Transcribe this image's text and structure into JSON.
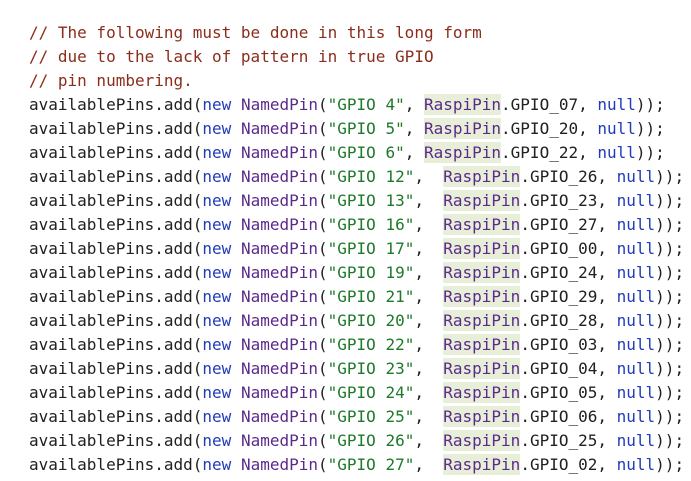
{
  "comments": [
    "// The following must be done in this long form",
    "// due to the lack of pattern in true GPIO",
    "// pin numbering."
  ],
  "tokens": {
    "call": "availablePins.add(",
    "new_kw": "new",
    "class_name": "NamedPin",
    "open_paren": "(",
    "type_ref": "RaspiPin",
    "null_kw": "null",
    "close": "));"
  },
  "pins": [
    {
      "name": "\"GPIO 4\"",
      "sep": ", ",
      "gpio": ".GPIO_07, "
    },
    {
      "name": "\"GPIO 5\"",
      "sep": ", ",
      "gpio": ".GPIO_20, "
    },
    {
      "name": "\"GPIO 6\"",
      "sep": ", ",
      "gpio": ".GPIO_22, "
    },
    {
      "name": "\"GPIO 12\"",
      "sep": ",  ",
      "gpio": ".GPIO_26, "
    },
    {
      "name": "\"GPIO 13\"",
      "sep": ",  ",
      "gpio": ".GPIO_23, "
    },
    {
      "name": "\"GPIO 16\"",
      "sep": ",  ",
      "gpio": ".GPIO_27, "
    },
    {
      "name": "\"GPIO 17\"",
      "sep": ",  ",
      "gpio": ".GPIO_00, "
    },
    {
      "name": "\"GPIO 19\"",
      "sep": ",  ",
      "gpio": ".GPIO_24, "
    },
    {
      "name": "\"GPIO 21\"",
      "sep": ",  ",
      "gpio": ".GPIO_29, "
    },
    {
      "name": "\"GPIO 20\"",
      "sep": ",  ",
      "gpio": ".GPIO_28, "
    },
    {
      "name": "\"GPIO 22\"",
      "sep": ",  ",
      "gpio": ".GPIO_03, "
    },
    {
      "name": "\"GPIO 23\"",
      "sep": ",  ",
      "gpio": ".GPIO_04, "
    },
    {
      "name": "\"GPIO 24\"",
      "sep": ",  ",
      "gpio": ".GPIO_05, "
    },
    {
      "name": "\"GPIO 25\"",
      "sep": ",  ",
      "gpio": ".GPIO_06, "
    },
    {
      "name": "\"GPIO 26\"",
      "sep": ",  ",
      "gpio": ".GPIO_25, "
    },
    {
      "name": "\"GPIO 27\"",
      "sep": ",  ",
      "gpio": ".GPIO_02, "
    }
  ]
}
